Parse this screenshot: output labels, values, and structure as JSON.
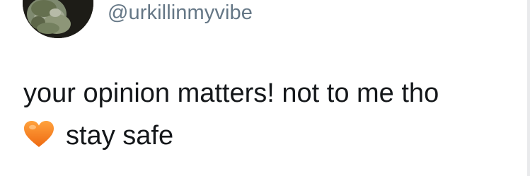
{
  "tweet": {
    "handle": "@urkillinmyvibe",
    "text_line_1": "your opinion matters! not to me tho",
    "text_line_2": "stay safe",
    "emoji": "orange-heart-icon"
  },
  "colors": {
    "background": "#ffffff",
    "handle": "#657786",
    "text": "#14171a",
    "heart": "#f4901e"
  }
}
